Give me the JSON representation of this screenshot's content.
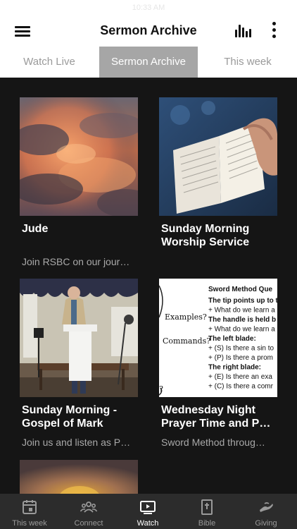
{
  "status": {
    "time": "10:33 AM"
  },
  "header": {
    "title": "Sermon Archive"
  },
  "tabs": [
    {
      "label": "Watch Live"
    },
    {
      "label": "Sermon Archive"
    },
    {
      "label": "This week"
    }
  ],
  "cards": [
    {
      "title": "Jude",
      "subtitle": "Join RSBC on our jour…"
    },
    {
      "title": "Sunday Morning Worship Service",
      "subtitle": ""
    },
    {
      "title": "Sunday Morning - Gospel of Mark",
      "subtitle": "Join us and listen as P…"
    },
    {
      "title": "Wednesday Night Prayer Time and P…",
      "subtitle": "Sword Method throug…"
    }
  ],
  "sword_thumb": {
    "heading": "Sword Method Que",
    "lines": [
      "The tip points up to t",
      "+ What do we learn a",
      "The handle is held b",
      "+ What do we learn a",
      "The left blade:",
      "+ (S) Is there a sin to",
      "+ (P) Is there a prom",
      "The right blade:",
      "+ (E) Is there an exa",
      "+ (C) Is there a comr"
    ],
    "hand": [
      "Examples?",
      "Commands?"
    ]
  },
  "bottom_nav": [
    {
      "label": "This week",
      "icon": "calendar-icon"
    },
    {
      "label": "Connect",
      "icon": "people-icon"
    },
    {
      "label": "Watch",
      "icon": "play-screen-icon"
    },
    {
      "label": "Bible",
      "icon": "bible-icon"
    },
    {
      "label": "Giving",
      "icon": "giving-hand-icon"
    }
  ],
  "colors": {
    "content_bg": "#151515",
    "active_tab": "#a6a6a6",
    "nav_bg": "#2c2c2c"
  }
}
